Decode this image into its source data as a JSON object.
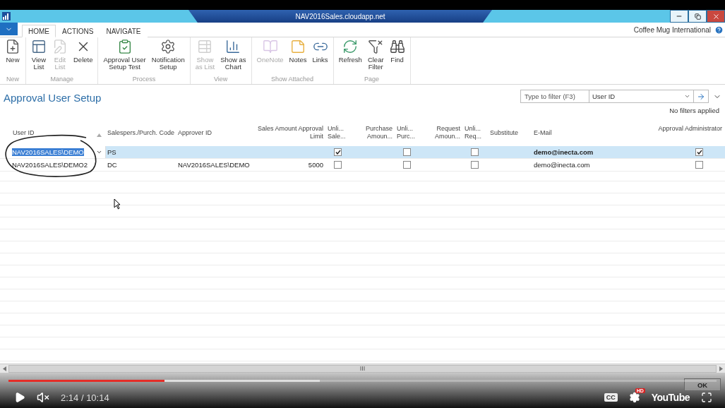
{
  "window": {
    "title": "NAV2016Sales.cloudapp.net"
  },
  "ribbon_tabs": [
    {
      "label": "HOME",
      "selected": true
    },
    {
      "label": "ACTIONS",
      "selected": false
    },
    {
      "label": "NAVIGATE",
      "selected": false
    }
  ],
  "company": "Coffee Mug International",
  "ribbon_groups": [
    {
      "label": "New",
      "buttons": [
        {
          "label": "New",
          "disabled": false
        }
      ]
    },
    {
      "label": "Manage",
      "buttons": [
        {
          "label": "View\nList",
          "disabled": false
        },
        {
          "label": "Edit\nList",
          "disabled": true
        },
        {
          "label": "Delete",
          "disabled": false
        }
      ]
    },
    {
      "label": "Process",
      "buttons": [
        {
          "label": "Approval User\nSetup Test",
          "disabled": false
        },
        {
          "label": "Notification\nSetup",
          "disabled": false
        }
      ]
    },
    {
      "label": "View",
      "buttons": [
        {
          "label": "Show\nas List",
          "disabled": true
        },
        {
          "label": "Show as\nChart",
          "disabled": false
        }
      ]
    },
    {
      "label": "Show Attached",
      "buttons": [
        {
          "label": "OneNote",
          "disabled": true
        },
        {
          "label": "Notes",
          "disabled": false
        },
        {
          "label": "Links",
          "disabled": false
        }
      ]
    },
    {
      "label": "Page",
      "buttons": [
        {
          "label": "Refresh",
          "disabled": false
        },
        {
          "label": "Clear\nFilter",
          "disabled": false
        },
        {
          "label": "Find",
          "disabled": false
        }
      ]
    }
  ],
  "page": {
    "title": "Approval User Setup"
  },
  "filter": {
    "placeholder": "Type to filter (F3)",
    "field": "User ID",
    "status": "No filters applied"
  },
  "table": {
    "columns": [
      {
        "label": "User ID",
        "kind": "user"
      },
      {
        "label": "Salespers./Purch. Code",
        "kind": "text"
      },
      {
        "label": "Approver ID",
        "kind": "text"
      },
      {
        "label": "Sales Amount Approval\nLimit",
        "kind": "number"
      },
      {
        "label": "Unli...\nSale...",
        "kind": "check"
      },
      {
        "label": "Purchase\nAmoun...",
        "kind": "number"
      },
      {
        "label": "Unli...\nPurc...",
        "kind": "check"
      },
      {
        "label": "Request\nAmoun...",
        "kind": "number"
      },
      {
        "label": "Unli...\nReq...",
        "kind": "check"
      },
      {
        "label": "Substitute",
        "kind": "text"
      },
      {
        "label": "E-Mail",
        "kind": "email"
      },
      {
        "label": "Approval Administrator",
        "kind": "check"
      }
    ],
    "rows": [
      {
        "selected": true,
        "cells": [
          "NAV2016SALES\\DEMO",
          "PS",
          null,
          null,
          true,
          null,
          false,
          null,
          false,
          null,
          "demo@inecta.com",
          true
        ]
      },
      {
        "selected": false,
        "cells": [
          "NAV2016SALES\\DEMO2",
          "DC",
          "NAV2016SALES\\DEMO",
          "5000",
          false,
          null,
          false,
          null,
          false,
          null,
          "demo@inecta.com",
          false
        ]
      }
    ]
  },
  "dialog_button": "OK",
  "player": {
    "progress": {
      "level": 0.22
    },
    "buffer": {
      "level": 0.44
    },
    "muted": true,
    "time": "2:14 / 10:14",
    "cc": "CC",
    "hd": "HD",
    "logo": "YouTube"
  }
}
